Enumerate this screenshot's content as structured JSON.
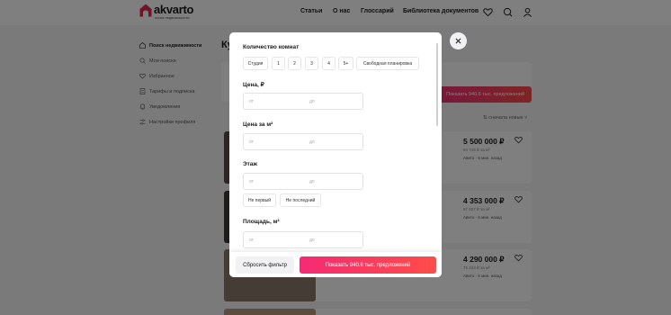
{
  "header": {
    "logo_name": "akvarto",
    "logo_sub": "поиск недвижимости",
    "nav": [
      "Статьи",
      "О нас",
      "Глоссарий",
      "Библиотека документов"
    ],
    "icons": [
      "heart-icon",
      "chat-search-icon",
      "user-icon"
    ]
  },
  "sidebar": {
    "items": [
      {
        "label": "Поиск недвижимости",
        "icon": "home-icon"
      },
      {
        "label": "Мои поиски",
        "icon": "search-icon"
      },
      {
        "label": "Избранное",
        "icon": "heart-icon"
      },
      {
        "label": "Тарифы и подписка",
        "icon": "document-icon"
      },
      {
        "label": "Уведомления",
        "icon": "bell-icon"
      },
      {
        "label": "Настройки профиля",
        "icon": "settings-icon"
      }
    ]
  },
  "background": {
    "title": "Ку",
    "show_button": "Показать 940.6 тыс. предложений",
    "sort_label": "сначала новые",
    "listings": [
      {
        "price": "5 500 000 ₽",
        "ppm": "94 745 ₽ за м²",
        "source": "Авито",
        "age": "6 мин. назад"
      },
      {
        "price": "4 353 000 ₽",
        "ppm": "57 927 ₽ за м²",
        "source": "Авито",
        "age": "6 мин. назад"
      },
      {
        "price": "4 290 000 ₽",
        "ppm": "75 423 ₽ за м²",
        "source": "Авито",
        "age": "6 мин. назад"
      }
    ]
  },
  "modal": {
    "rooms": {
      "title": "Количество комнат",
      "options": [
        "Студия",
        "1",
        "2",
        "3",
        "4",
        "5+",
        "Свободная планировка"
      ]
    },
    "price": {
      "title": "Цена, ₽",
      "from": "от",
      "to": "до"
    },
    "price_per_m": {
      "title": "Цена за м²",
      "from": "от",
      "to": "до"
    },
    "floor": {
      "title": "Этаж",
      "from": "от",
      "to": "до",
      "not_first": "Не первый",
      "not_last": "Не последний"
    },
    "area": {
      "title": "Площадь, м²",
      "from": "от",
      "to": "до"
    },
    "footer": {
      "reset": "Сбросить фильтр",
      "show": "Показать 940.6 тыс. предложений"
    }
  },
  "colors": {
    "accent": "#f52a74",
    "accent_end": "#ff4d48",
    "logo": "#e8264f",
    "overlay": "rgba(0,0,0,0.5)"
  }
}
